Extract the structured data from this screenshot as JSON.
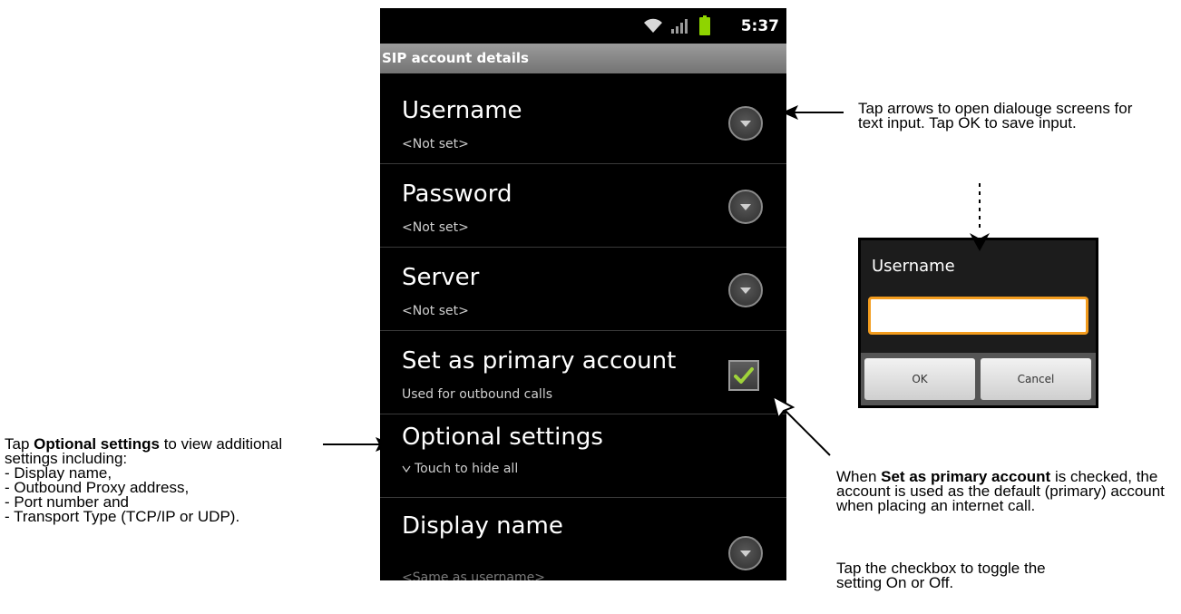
{
  "status_bar": {
    "time": "5:37",
    "icons": [
      "wifi-icon",
      "signal-icon",
      "battery-icon"
    ]
  },
  "title_bar": {
    "title": "SIP account details"
  },
  "settings": {
    "username": {
      "title": "Username",
      "summary": "<Not set>"
    },
    "password": {
      "title": "Password",
      "summary": "<Not set>"
    },
    "server": {
      "title": "Server",
      "summary": "<Not set>"
    },
    "primary": {
      "title": "Set as primary account",
      "summary": "Used for outbound calls",
      "checked": true
    },
    "optional": {
      "title": "Optional settings",
      "summary": "Touch to hide all",
      "summary_icon": "triangle-down-icon"
    },
    "display_name": {
      "title": "Display name",
      "summary": "<Same as username>"
    }
  },
  "dialog": {
    "title": "Username",
    "input_value": "",
    "ok_label": "OK",
    "cancel_label": "Cancel"
  },
  "annotations": {
    "arrows_note": "Tap arrows to open dialouge screens for text input. Tap OK to save input.",
    "optional_note": {
      "prefix": "Tap ",
      "bold": "Optional settings",
      "suffix": " to view additional settings including:",
      "items": [
        "- Display name,",
        "- Outbound Proxy address,",
        "- Port number and",
        "- Transport Type (TCP/IP or UDP)."
      ]
    },
    "primary_note": {
      "prefix": "When ",
      "bold": "Set as primary account",
      "suffix": " is checked, the account is used as the default (primary) account when placing an internet call."
    },
    "checkbox_note": "Tap the checkbox to toggle the setting On or Off."
  },
  "colors": {
    "phone_background": "#000000",
    "title_bar": "#8a8a8a",
    "checkmark": "#9fd33a",
    "battery": "#8fd400",
    "input_focus": "#f39c1e"
  }
}
